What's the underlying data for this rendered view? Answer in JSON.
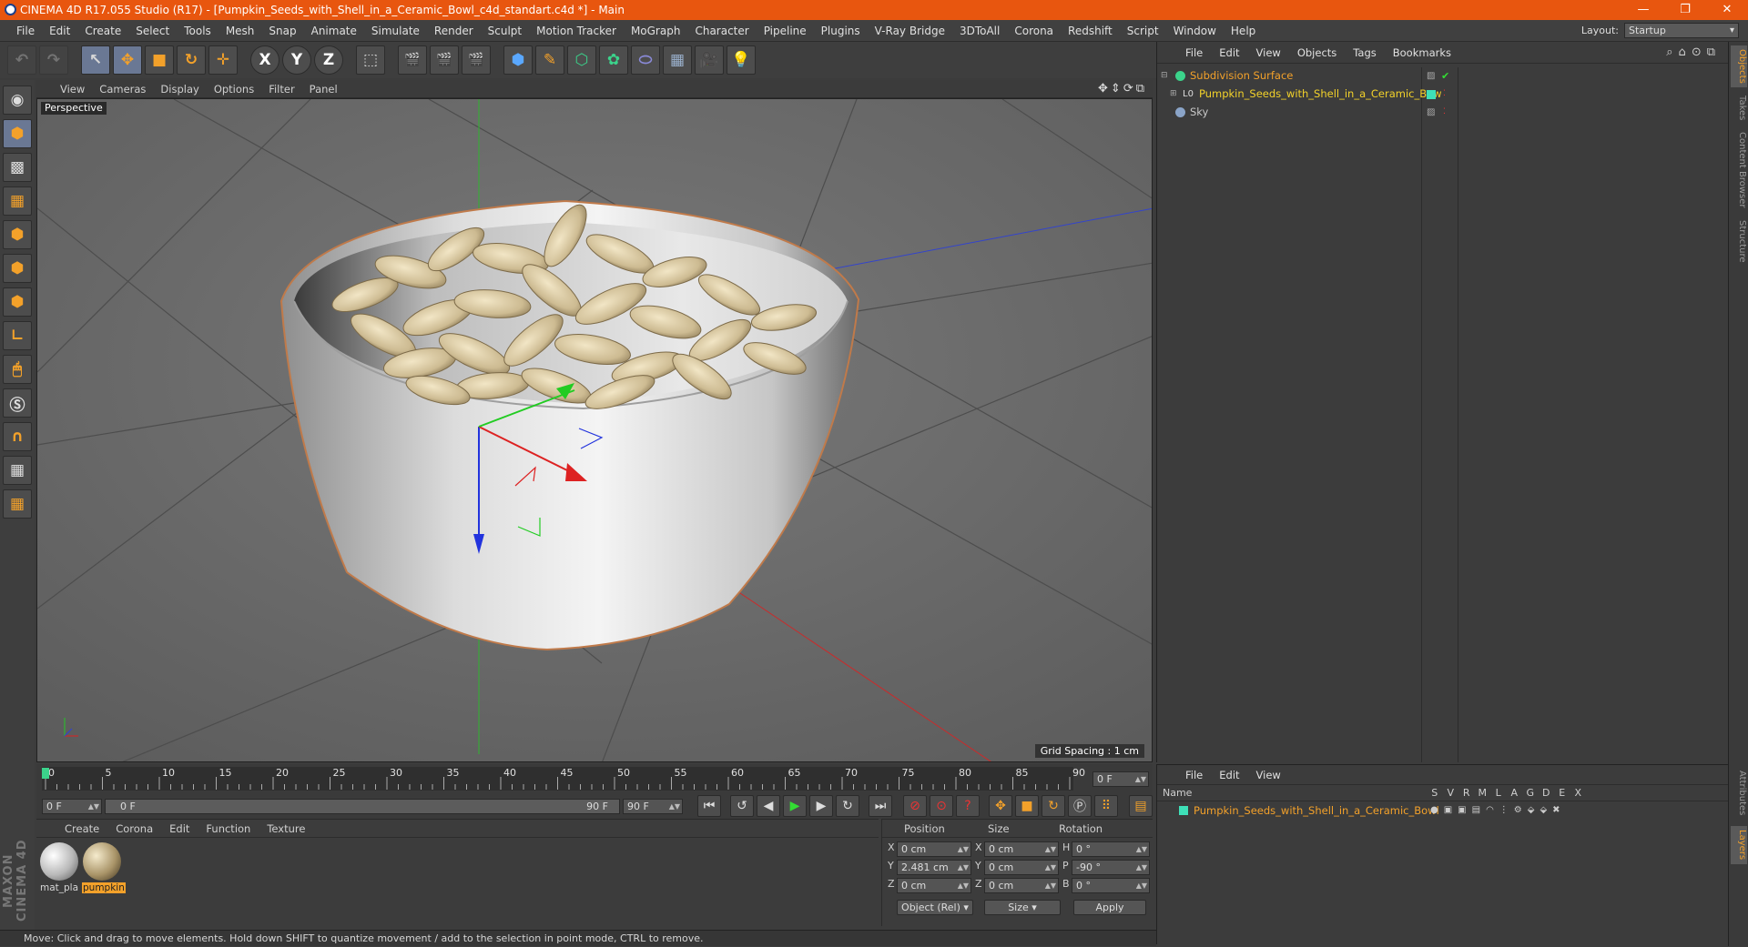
{
  "window": {
    "title": "CINEMA 4D R17.055 Studio (R17) - [Pumpkin_Seeds_with_Shell_in_a_Ceramic_Bowl_c4d_standart.c4d *] - Main",
    "controls": [
      "—",
      "❐",
      "✕"
    ]
  },
  "menubar": {
    "items": [
      "File",
      "Edit",
      "Create",
      "Select",
      "Tools",
      "Mesh",
      "Snap",
      "Animate",
      "Simulate",
      "Render",
      "Sculpt",
      "Motion Tracker",
      "MoGraph",
      "Character",
      "Pipeline",
      "Plugins",
      "V-Ray Bridge",
      "3DToAll",
      "Corona",
      "Redshift",
      "Script",
      "Window",
      "Help"
    ],
    "layout_label": "Layout:",
    "layout_value": "Startup"
  },
  "toolbar": {
    "icons": [
      "undo-icon",
      "redo-icon",
      "select-arrow-icon",
      "move-icon",
      "scale-icon",
      "rotate-icon",
      "multi-transform-icon",
      "x-axis-icon",
      "y-axis-icon",
      "z-axis-icon",
      "coordinate-system-icon",
      "render-view-icon",
      "render-picture-viewer-icon",
      "render-settings-icon",
      "cube-primitive-icon",
      "pen-spline-icon",
      "subdivision-icon",
      "cloner-icon",
      "deformer-icon",
      "floor-icon",
      "camera-icon",
      "light-icon"
    ],
    "glyphs": [
      "↶",
      "↷",
      "↖",
      "✥",
      "■",
      "↻",
      "✛",
      "X",
      "Y",
      "Z",
      "⬚",
      "🎬",
      "🎬",
      "🎬",
      "⬢",
      "✎",
      "⬡",
      "✿",
      "⬭",
      "▦",
      "🎥",
      "💡"
    ]
  },
  "viewport": {
    "menu": [
      "View",
      "Cameras",
      "Display",
      "Options",
      "Filter",
      "Panel"
    ],
    "label": "Perspective",
    "grid_spacing": "Grid Spacing : 1 cm",
    "nav_icons": "✥⇕⟳⧉"
  },
  "timeline": {
    "ticks": [
      "0",
      "5",
      "10",
      "15",
      "20",
      "25",
      "30",
      "35",
      "40",
      "45",
      "50",
      "55",
      "60",
      "65",
      "70",
      "75",
      "80",
      "85",
      "90"
    ],
    "end_frame": "0 F",
    "start_field": "0 F",
    "range_start": "0 F",
    "range_end": "90 F",
    "max_field": "90 F"
  },
  "materials": {
    "menu": [
      "Create",
      "Corona",
      "Edit",
      "Function",
      "Texture"
    ],
    "items": [
      {
        "name": "mat_pla",
        "selected": false
      },
      {
        "name": "pumpkin",
        "selected": true
      }
    ]
  },
  "coords": {
    "headers": [
      "Position",
      "Size",
      "Rotation"
    ],
    "rows": [
      {
        "axis": "X",
        "pos": "0 cm",
        "size_axis": "X",
        "size": "0 cm",
        "rot_axis": "H",
        "rot": "0 °"
      },
      {
        "axis": "Y",
        "pos": "2.481 cm",
        "size_axis": "Y",
        "size": "0 cm",
        "rot_axis": "P",
        "rot": "-90 °"
      },
      {
        "axis": "Z",
        "pos": "0 cm",
        "size_axis": "Z",
        "size": "0 cm",
        "rot_axis": "B",
        "rot": "0 °"
      }
    ],
    "mode": "Object (Rel)",
    "size_mode": "Size",
    "apply": "Apply"
  },
  "status": "Move: Click and drag to move elements. Hold down SHIFT to quantize movement / add to the selection in point mode, CTRL to remove.",
  "objects": {
    "menu": [
      "File",
      "Edit",
      "View",
      "Objects",
      "Tags",
      "Bookmarks"
    ],
    "rows": [
      {
        "name": "Subdivision Surface",
        "color": "#f3a12a"
      },
      {
        "name": "Pumpkin_Seeds_with_Shell_in_a_Ceramic_Bow",
        "color": "#f3d22a"
      },
      {
        "name": "Sky",
        "color": "#c8c8c8"
      }
    ]
  },
  "layers": {
    "menu": [
      "File",
      "Edit",
      "View"
    ],
    "name_header": "Name",
    "columns": [
      "S",
      "V",
      "R",
      "M",
      "L",
      "A",
      "G",
      "D",
      "E",
      "X"
    ],
    "row": "Pumpkin_Seeds_with_Shell_in_a_Ceramic_Bowl"
  },
  "right_tabs": [
    "Objects",
    "Takes",
    "Content Browser",
    "Structure"
  ],
  "right_tabs_bottom": [
    "Attributes",
    "Layers"
  ],
  "logo": "MAXON CINEMA 4D",
  "colors": {
    "accent": "#f3a12a",
    "title_bar": "#e8560f",
    "selection_blue": "#6a7894"
  }
}
